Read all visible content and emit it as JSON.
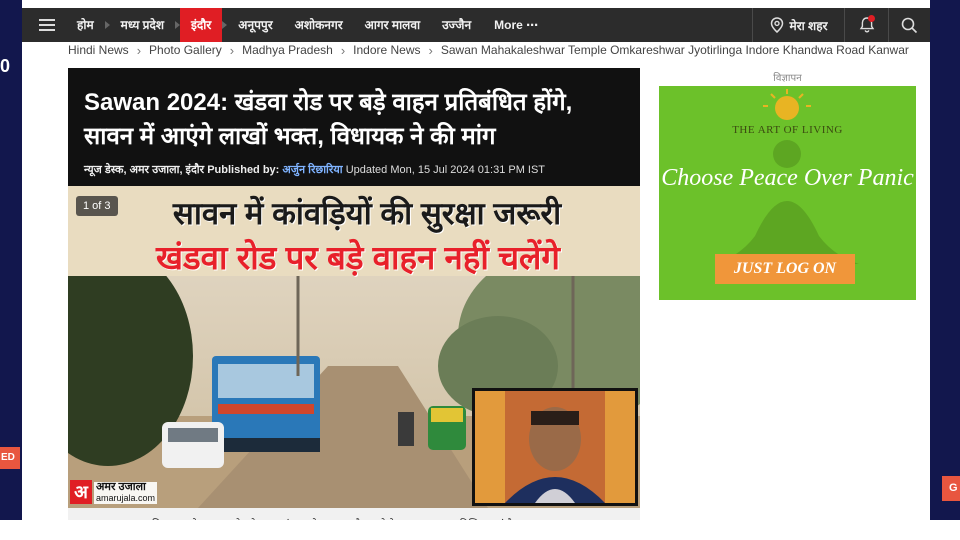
{
  "nav": {
    "items": [
      {
        "label": "होम"
      },
      {
        "label": "मध्य प्रदेश"
      },
      {
        "label": "इंदौर",
        "active": true
      },
      {
        "label": "अनूपपुर"
      },
      {
        "label": "अशोकनगर"
      },
      {
        "label": "आगर मालवा"
      },
      {
        "label": "उज्जैन"
      }
    ],
    "more_label": "More",
    "city_label": "मेरा शहर",
    "icons": {
      "menu": "hamburger-icon",
      "city": "location-pin-icon",
      "notifications": "bell-icon",
      "search": "search-icon"
    }
  },
  "breadcrumb": [
    "Hindi News",
    "Photo Gallery",
    "Madhya Pradesh",
    "Indore News",
    "Sawan Mahakaleshwar Temple Omkareshwar Jyotirlinga Indore Khandwa Road Kanwar"
  ],
  "article": {
    "title": "Sawan 2024: खंडवा रोड पर बड़े वाहन प्रतिबंधित होंगे, सावन में आएंगे लाखों भक्त, विधायक ने की मांग",
    "meta": {
      "desk": "न्यूज डेस्क, अमर उजाला, इंदौर",
      "published_by_label": "Published by:",
      "author": "अर्जुन रिछारिया",
      "updated": "Updated Mon, 15 Jul 2024 01:31 PM IST"
    }
  },
  "gallery": {
    "counter": "1 of 3",
    "overlay_line1": "सावन में कांवड़ियों की सुरक्षा जरूरी",
    "overlay_line2": "खंडवा रोड पर बड़े वाहन नहीं चलेंगे",
    "brand_name": "अमर उजाला",
    "brand_url": "amarujala.com",
    "caption": "विधायक गोलू शुक्ला ने बड़े वाहन बंद करने का कहा है। - फोटो : अमर उजाला, डिजिटल, इंदौर"
  },
  "ad": {
    "label": "विज्ञापन",
    "brand": "THE ART OF LIVING",
    "headline": "Choose Peace Over Panic",
    "cta": "JUST LOG ON"
  },
  "side": {
    "left_mark": "0",
    "left_cut": "ED",
    "right_cut": "G"
  },
  "colors": {
    "nav_bg": "#2c2c2c",
    "nav_active": "#e01e24",
    "side_rail": "#12174d",
    "ad_bg": "#6cc12a",
    "ad_button": "#f0963a",
    "overlay_red": "#e8202a"
  }
}
